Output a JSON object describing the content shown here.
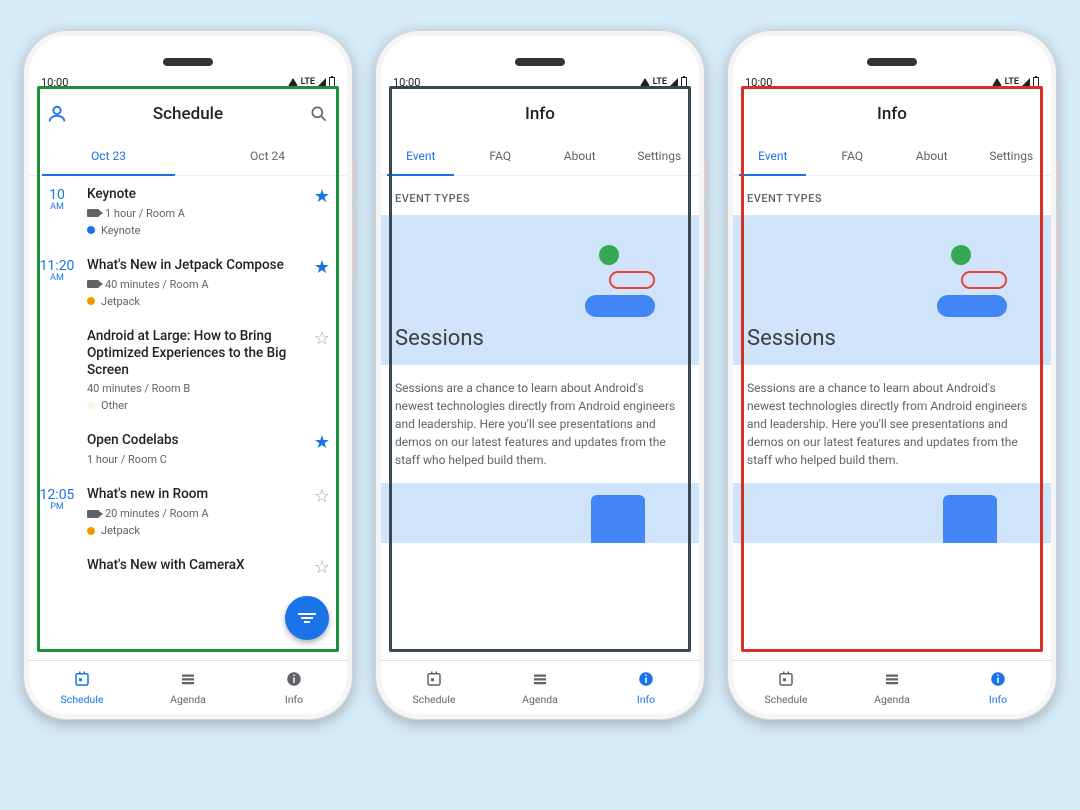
{
  "status": {
    "time": "10:00",
    "lte": "LTE"
  },
  "overlays": {
    "p1": "#1e8e3e",
    "p2": "#37474f",
    "p3": "#d93025"
  },
  "phone1": {
    "title": "Schedule",
    "tabs": [
      "Oct 23",
      "Oct 24"
    ],
    "activeTab": 0,
    "items": [
      {
        "time": "10",
        "ampm": "AM",
        "title": "Keynote",
        "meta": "1 hour / Room A",
        "chip": "Keynote",
        "chipColor": "#1a73e8",
        "starred": true,
        "hasCam": true
      },
      {
        "time": "11:20",
        "ampm": "AM",
        "title": "What's New in Jetpack Compose",
        "meta": "40 minutes / Room A",
        "chip": "Jetpack",
        "chipColor": "#f29900",
        "starred": true,
        "hasCam": true
      },
      {
        "time": "",
        "ampm": "",
        "title": "Android at Large: How to Bring Optimized Experiences to the Big Screen",
        "meta": "40 minutes / Room B",
        "chip": "Other",
        "chipColor": "#fef7e0",
        "starred": false,
        "hasCam": false
      },
      {
        "time": "",
        "ampm": "",
        "title": "Open Codelabs",
        "meta": "1 hour / Room C",
        "chip": "",
        "chipColor": "",
        "starred": true,
        "hasCam": false
      },
      {
        "time": "12:05",
        "ampm": "PM",
        "title": "What's new in Room",
        "meta": "20 minutes / Room A",
        "chip": "Jetpack",
        "chipColor": "#f29900",
        "starred": false,
        "hasCam": true
      },
      {
        "time": "",
        "ampm": "",
        "title": "What's New with CameraX",
        "meta": "",
        "chip": "",
        "chipColor": "",
        "starred": false,
        "hasCam": false
      }
    ]
  },
  "phoneInfo": {
    "title": "Info",
    "tabs": [
      "Event",
      "FAQ",
      "About",
      "Settings"
    ],
    "activeTab": 0,
    "sectionLabel": "EVENT TYPES",
    "sessionsTitle": "Sessions",
    "sessionsDesc": "Sessions are a chance to learn about Android's newest technologies directly from Android engineers and leadership. Here you'll see presentations and demos on our latest features and updates from the staff who helped build them."
  },
  "bottomNav": {
    "items": [
      "Schedule",
      "Agenda",
      "Info"
    ],
    "activeP1": 0,
    "activeInfo": 2
  }
}
